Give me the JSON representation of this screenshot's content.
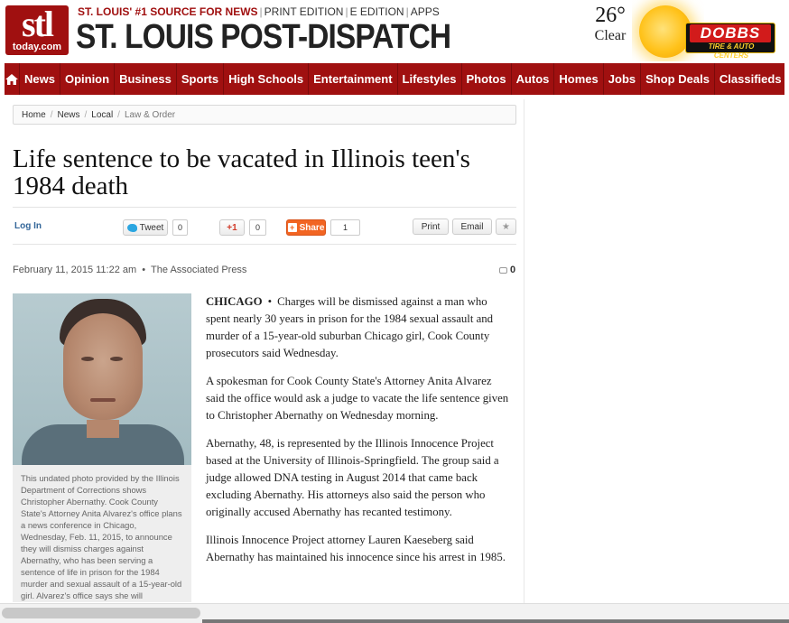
{
  "masthead": {
    "logo_top": "stl",
    "logo_bottom": "today.com",
    "tagline_highlight": "ST. LOUIS' #1 SOURCE FOR NEWS",
    "tagline_links": [
      "PRINT EDITION",
      "E EDITION",
      "APPS"
    ],
    "title": "ST. LOUIS POST-DISPATCH"
  },
  "weather": {
    "temp": "26°",
    "condition": "Clear",
    "icon": "sun-icon"
  },
  "ad": {
    "brand": "DOBBS",
    "sub": "TIRE & AUTO CENTERS"
  },
  "nav": {
    "home_icon": "home-icon",
    "items": [
      "News",
      "Opinion",
      "Business",
      "Sports",
      "High Schools",
      "Entertainment",
      "Lifestyles",
      "Photos",
      "Autos",
      "Homes",
      "Jobs",
      "Shop Deals",
      "Classifieds"
    ]
  },
  "breadcrumb": [
    "Home",
    "News",
    "Local",
    "Law & Order"
  ],
  "headline": "Life sentence to be vacated in Illinois teen's 1984 death",
  "toolbar": {
    "login": "Log In",
    "tweet": "Tweet",
    "tweet_count": "0",
    "gplus": "+1",
    "gplus_count": "0",
    "share": "Share",
    "share_count": "1",
    "print": "Print",
    "email": "Email",
    "favorite_icon": "star-icon"
  },
  "byline": {
    "date": "February 11, 2015 11:22 am",
    "source": "The Associated Press",
    "comment_count": "0"
  },
  "photo": {
    "caption": "This undated photo provided by the Illinois Department of Corrections shows Christopher Abernathy. Cook County State's Attorney Anita Alvarez's office plans a news conference in Chicago, Wednesday, Feb. 11, 2015, to announce they will dismiss charges against Abernathy, who has been serving a sentence of life in prison for the 1984 murder and sexual assault of a 15-year-old girl. Alvarez's office says she will"
  },
  "article": {
    "dateline": "CHICAGO",
    "bullet": "•",
    "p1": "Charges will be dismissed against a man who spent nearly 30 years in prison for the 1984 sexual assault and murder of a 15-year-old suburban Chicago girl, Cook County prosecutors said Wednesday.",
    "p2": "A spokesman for Cook County State's Attorney Anita Alvarez said the office would ask a judge to vacate the life sentence given to Christopher Abernathy on Wednesday morning.",
    "p3": "Abernathy, 48, is represented by the Illinois Innocence Project based at the University of Illinois-Springfield. The group said a judge allowed DNA testing in August 2014 that came back excluding Abernathy. His attorneys also said the person who originally accused Abernathy has recanted testimony.",
    "p4": "Illinois Innocence Project attorney Lauren Kaeseberg said Abernathy has maintained his innocence since his arrest in 1985."
  }
}
